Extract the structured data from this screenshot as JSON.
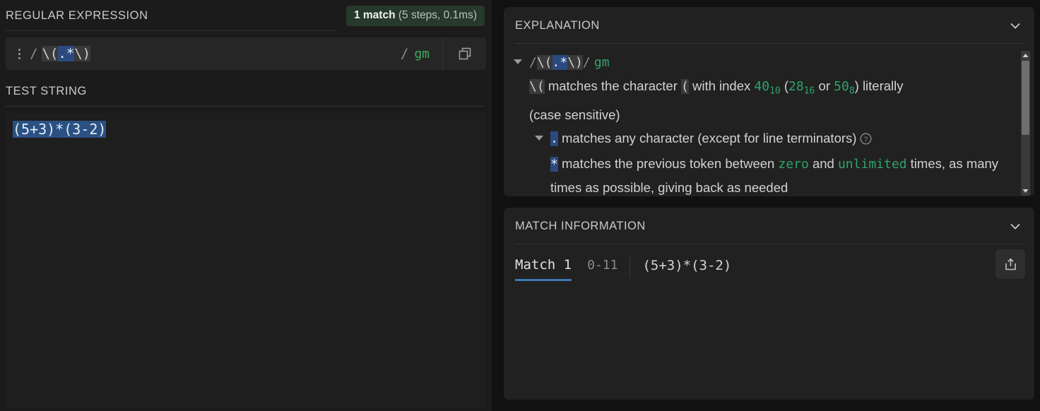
{
  "left": {
    "regex_section_title": "REGULAR EXPRESSION",
    "match_badge": {
      "count_label": "1 match",
      "detail_label": " (5 steps, 0.1ms)",
      "bg_color": "#26392a"
    },
    "regex_input": {
      "delimiter_open": "/",
      "delimiter_close": "/",
      "pattern_parts": {
        "escaped_open": "\\(",
        "selected": ".*",
        "escaped_close": "\\)"
      },
      "full_pattern": "\\(.*\\)",
      "flags": "gm",
      "selection_color": "#2b4a80"
    },
    "test_section_title": "TEST STRING",
    "test_string": {
      "value": "(5+3)*(3-2)",
      "highlight_color": "#2b5183"
    }
  },
  "explanation": {
    "panel_title": "EXPLANATION",
    "header_line": {
      "delim_open": "/",
      "esc_open": "\\(",
      "selected": ".*",
      "esc_close": "\\)",
      "delim_close": "/",
      "flags": "gm"
    },
    "line1": {
      "token": "\\(",
      "text_a": " matches the character ",
      "literal": "(",
      "text_b": " with index ",
      "dec": "40",
      "dec_sub": "10",
      "text_c": " (",
      "hex": "28",
      "hex_sub": "16",
      "text_d": " or ",
      "oct": "50",
      "oct_sub": "8",
      "text_e": ") literally",
      "line2": "(case sensitive)"
    },
    "line2": {
      "token": ".",
      "text": " matches any character (except for line terminators)"
    },
    "line3": {
      "token": "*",
      "text_a": " matches the previous token between ",
      "min": "zero",
      "text_b": " and ",
      "max": "unlimited",
      "text_c": " times, as many times as possible, giving back as needed"
    },
    "accent_green": "#2fa36a"
  },
  "match_info": {
    "panel_title": "MATCH INFORMATION",
    "tab_label": "Match 1",
    "range": "0-11",
    "value": "(5+3)*(3-2)",
    "underline_color": "#3d77b8"
  }
}
